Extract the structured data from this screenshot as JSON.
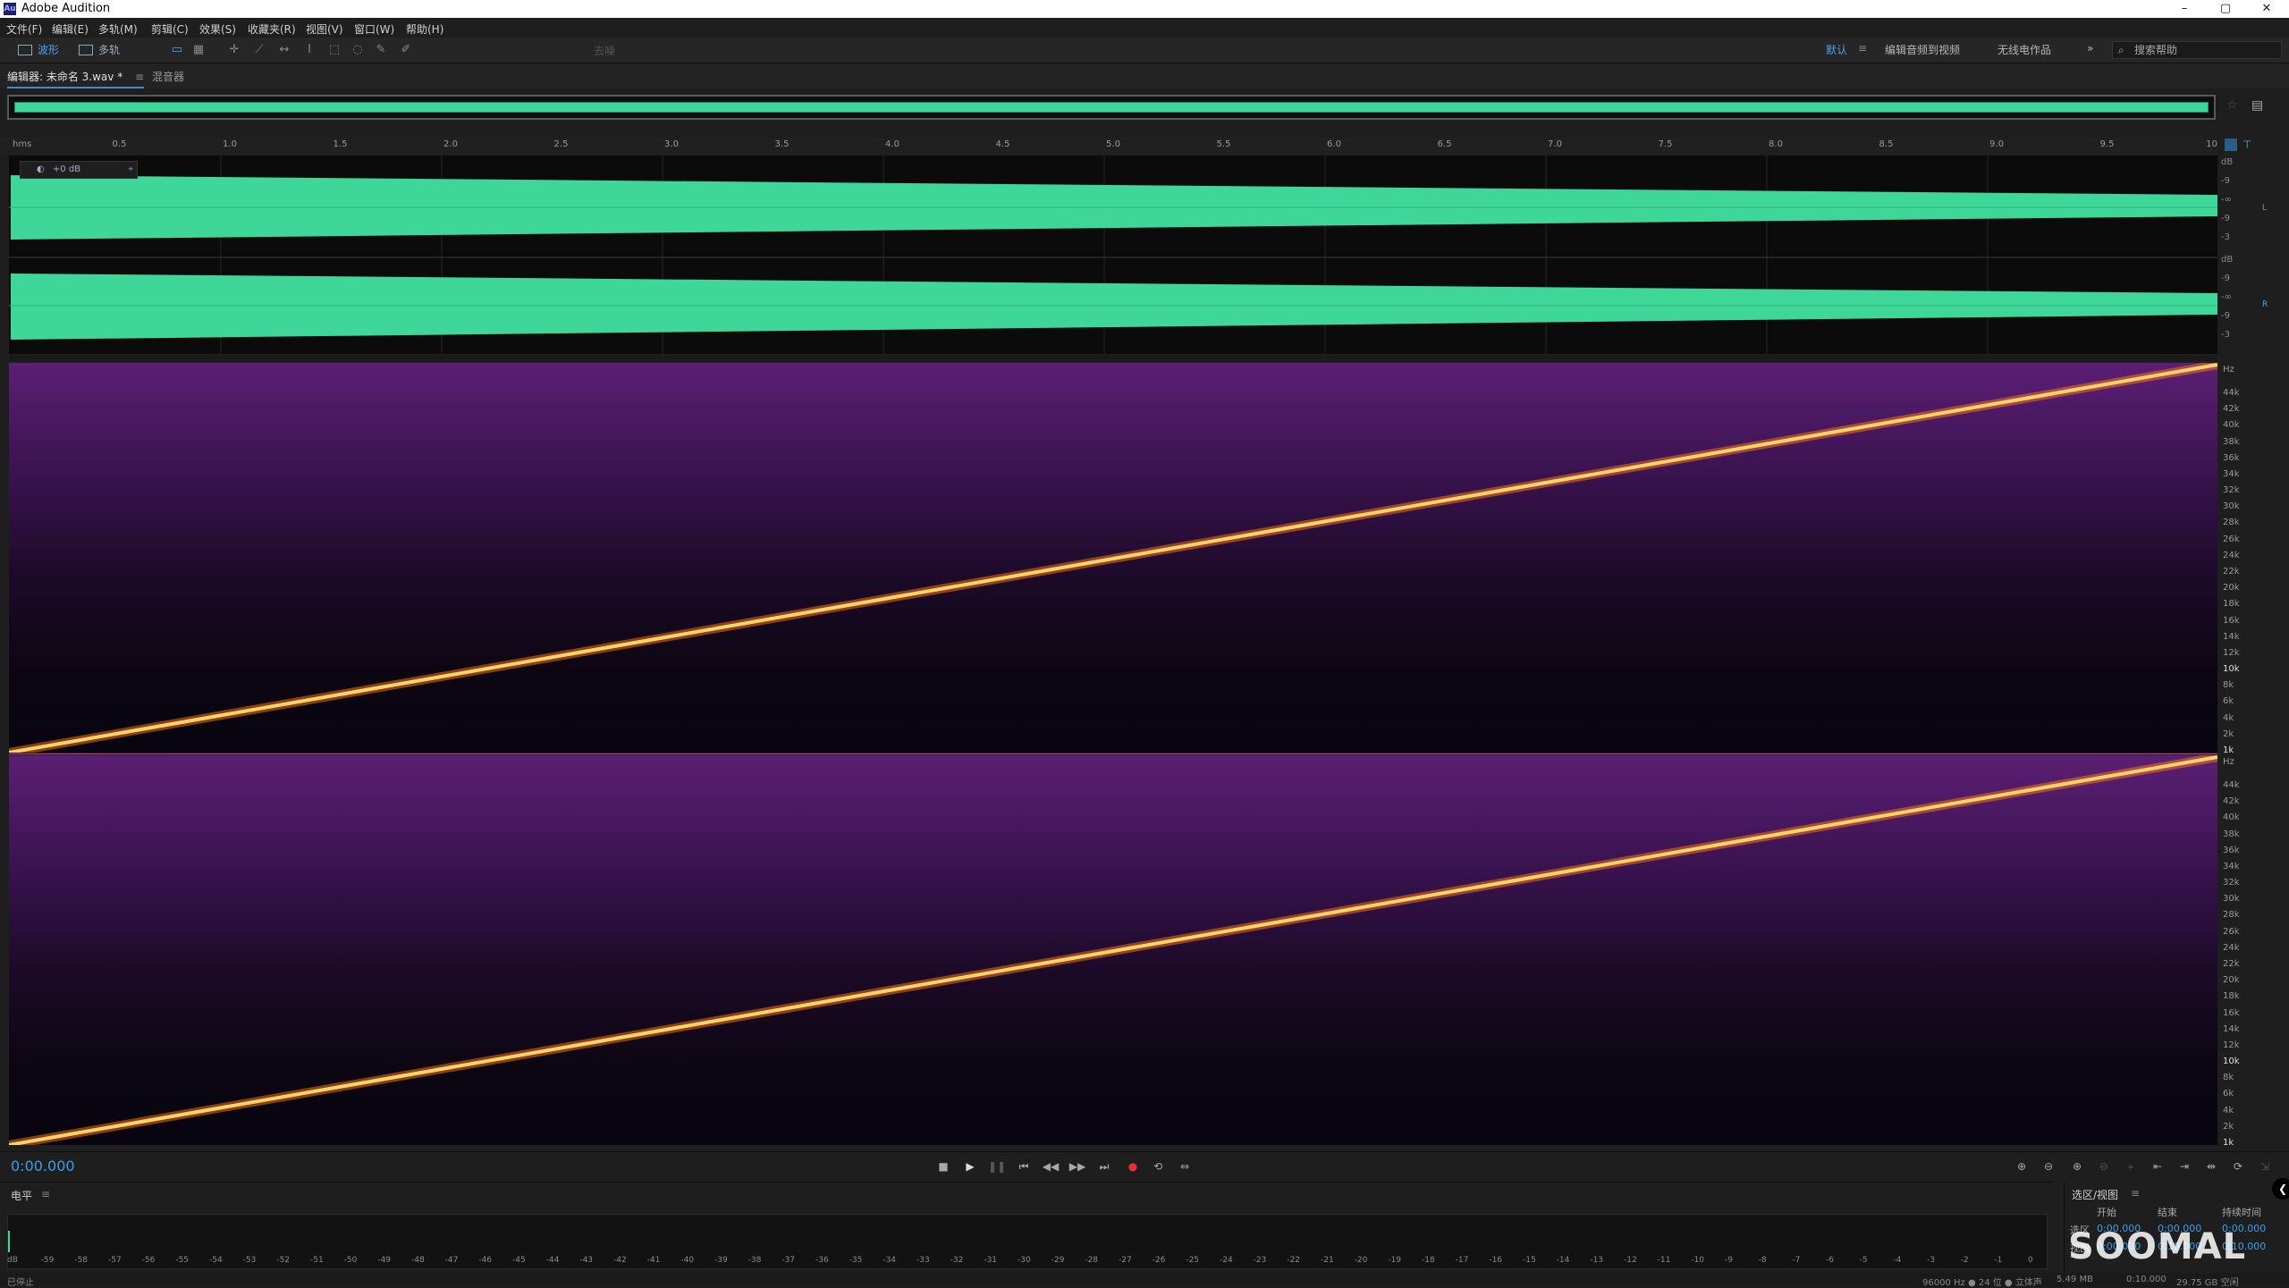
{
  "window": {
    "app_title": "Adobe Audition",
    "logo_text": "Au",
    "controls": {
      "minimize": "–",
      "maximize": "▢",
      "close": "✕"
    }
  },
  "menu": [
    "文件(F)",
    "编辑(E)",
    "多轨(M)",
    "剪辑(C)",
    "效果(S)",
    "收藏夹(R)",
    "视图(V)",
    "窗口(W)",
    "帮助(H)"
  ],
  "toolbar": {
    "mode_waveform": "波形",
    "mode_multitrack": "多轨",
    "disabled_label": "去噪",
    "workspaces": [
      "默认",
      "编辑音频到视频",
      "无线电作品"
    ],
    "workspace_menu_icon": "≡",
    "more_icon": "»",
    "search_placeholder": "搜索帮助"
  },
  "editor": {
    "tab_label": "编辑器: 未命名 3.wav *",
    "tab_menu": "≡",
    "mixer_tab": "混音器",
    "gain_label": "+0 dB"
  },
  "ruler": {
    "unit": "hms",
    "ticks": [
      "0.5",
      "1.0",
      "1.5",
      "2.0",
      "2.5",
      "3.0",
      "3.5",
      "4.0",
      "4.5",
      "5.0",
      "5.5",
      "6.0",
      "6.5",
      "7.0",
      "7.5",
      "8.0",
      "8.5",
      "9.0",
      "9.5",
      "10"
    ]
  },
  "waveform": {
    "channel_L": "L",
    "channel_R": "R",
    "db_unit": "dB",
    "db_scale": [
      "-9",
      "-∞",
      "-9",
      "-3"
    ],
    "color": "#3fd69a"
  },
  "spectral": {
    "hz_unit": "Hz",
    "hz_scale": [
      "44k",
      "42k",
      "40k",
      "38k",
      "36k",
      "34k",
      "32k",
      "30k",
      "28k",
      "26k",
      "24k",
      "22k",
      "20k",
      "18k",
      "16k",
      "14k",
      "12k",
      "10k",
      "8k",
      "6k",
      "4k",
      "2k",
      "1k"
    ],
    "sweep_color": "#ffd36a"
  },
  "transport": {
    "timecode": "0:00.000",
    "record_color": "#e0332f"
  },
  "level": {
    "panel_title": "电平",
    "panel_menu": "≡",
    "scale": [
      "dB",
      "-59",
      "-58",
      "-57",
      "-56",
      "-55",
      "-54",
      "-53",
      "-52",
      "-51",
      "-50",
      "-49",
      "-48",
      "-47",
      "-46",
      "-45",
      "-44",
      "-43",
      "-42",
      "-41",
      "-40",
      "-39",
      "-38",
      "-37",
      "-36",
      "-35",
      "-34",
      "-33",
      "-32",
      "-31",
      "-30",
      "-29",
      "-28",
      "-27",
      "-26",
      "-25",
      "-24",
      "-23",
      "-22",
      "-21",
      "-20",
      "-19",
      "-18",
      "-17",
      "-16",
      "-15",
      "-14",
      "-13",
      "-12",
      "-11",
      "-10",
      "-9",
      "-8",
      "-7",
      "-6",
      "-5",
      "-4",
      "-3",
      "-2",
      "-1",
      "0"
    ]
  },
  "selection_panel": {
    "title": "选区/视图",
    "menu": "≡",
    "col_start": "开始",
    "col_end": "结束",
    "col_duration": "持续时间",
    "row_selection": "选区",
    "row_view": "视图",
    "values": [
      "0:00.000",
      "0:00.000",
      "0:00.000",
      "0:00.000",
      "0:10.000",
      "0:10.000"
    ]
  },
  "status": {
    "left": "已停止",
    "sample_info": "96000 Hz ● 24 位 ● 立体声",
    "size": "5.49 MB",
    "duration": "0:10.000",
    "free": "29.75 GB 空闲"
  },
  "watermark": "SOOMAL"
}
